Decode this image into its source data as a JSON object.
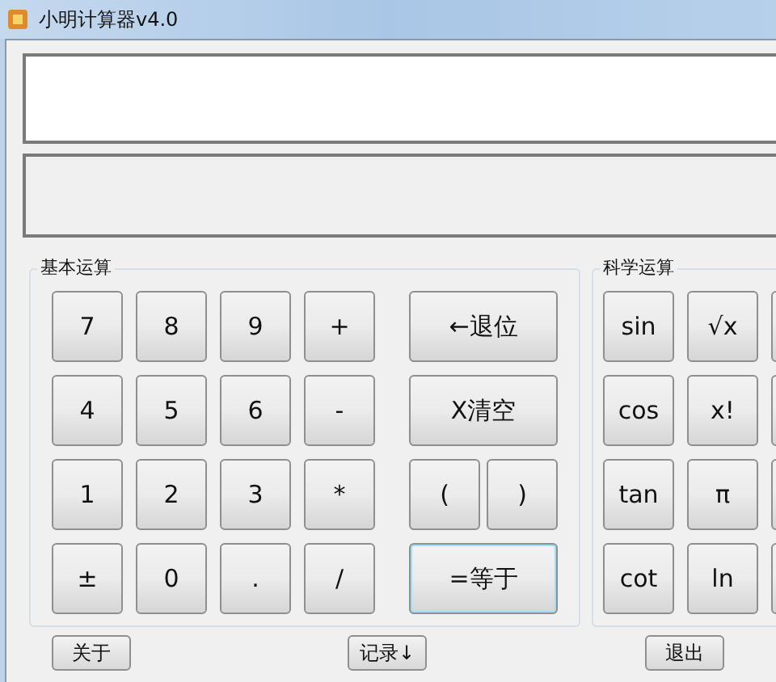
{
  "window": {
    "title": "小明计算器v4.0"
  },
  "basic": {
    "title": "基本运算",
    "rows": [
      [
        {
          "label": "7",
          "kind": "key"
        },
        {
          "label": "8",
          "kind": "key"
        },
        {
          "label": "9",
          "kind": "key"
        },
        {
          "label": "+",
          "kind": "key"
        },
        {
          "label": "←退位",
          "kind": "wide",
          "default": false
        }
      ],
      [
        {
          "label": "4",
          "kind": "key"
        },
        {
          "label": "5",
          "kind": "key"
        },
        {
          "label": "6",
          "kind": "key"
        },
        {
          "label": "-",
          "kind": "key"
        },
        {
          "label": "X清空",
          "kind": "wide",
          "default": false
        }
      ],
      [
        {
          "label": "1",
          "kind": "key"
        },
        {
          "label": "2",
          "kind": "key"
        },
        {
          "label": "3",
          "kind": "key"
        },
        {
          "label": "*",
          "kind": "key"
        },
        {
          "label": "(",
          "kind": "half"
        },
        {
          "label": ")",
          "kind": "half"
        }
      ],
      [
        {
          "label": "±",
          "kind": "key"
        },
        {
          "label": "0",
          "kind": "key"
        },
        {
          "label": ".",
          "kind": "key"
        },
        {
          "label": "/",
          "kind": "key"
        },
        {
          "label": "=等于",
          "kind": "wide",
          "default": true
        }
      ]
    ]
  },
  "science": {
    "title": "科学运算",
    "rows": [
      [
        {
          "label": "sin"
        },
        {
          "label": "√x"
        }
      ],
      [
        {
          "label": "cos"
        },
        {
          "label": "x!"
        }
      ],
      [
        {
          "label": "tan"
        },
        {
          "label": "π"
        }
      ],
      [
        {
          "label": "cot"
        },
        {
          "label": "ln"
        }
      ]
    ]
  },
  "bottom_buttons": [
    "关于",
    "记录↓",
    "退出"
  ]
}
